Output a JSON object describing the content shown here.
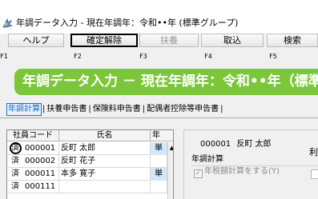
{
  "window": {
    "title": "年調データ入力 - 現在年調年：令和••年 (標準グループ)",
    "icon": "app-icon"
  },
  "toolbar": {
    "buttons": [
      {
        "label": "ヘルプ",
        "enabled": true
      },
      {
        "label": "確定解除",
        "enabled": true,
        "highlighted": true
      },
      {
        "label": "扶養",
        "enabled": false
      },
      {
        "label": "取込",
        "enabled": true
      },
      {
        "label": "検索",
        "enabled": true
      }
    ],
    "fkeys": [
      "F1",
      "F2",
      "F3",
      "F4",
      "F5"
    ]
  },
  "banner": {
    "title": "年調データ入力 － 現在年調年：令和••年（標準"
  },
  "tabs": {
    "items": [
      {
        "label": "年調計算",
        "active": true
      },
      {
        "label": "扶養申告書",
        "active": false
      },
      {
        "label": "保険料申告書",
        "active": false
      },
      {
        "label": "配偶者控除等申告書",
        "active": false
      }
    ],
    "separator": "|"
  },
  "employee_list": {
    "columns": [
      "社員コード",
      "氏名",
      "年"
    ],
    "rows": [
      {
        "status": "済",
        "code": "000001",
        "name": "反町 太郎",
        "year": "単",
        "selected": true
      },
      {
        "status": "済",
        "code": "000002",
        "name": "反町 花子",
        "year": "",
        "selected": false
      },
      {
        "status": "済",
        "code": "000011",
        "name": "本多 寛子",
        "year": "単",
        "selected": false
      },
      {
        "status": "済",
        "code": "000111",
        "name": "",
        "year": "",
        "selected": false
      }
    ],
    "scroll_up_icon": "triangle-up-icon"
  },
  "detail": {
    "employee_code": "000001",
    "employee_name": "反町 太郎",
    "group_label": "年調計算",
    "checkbox_label": "年税額計算をする(Y)",
    "checkbox_checked": true,
    "side_label": "利"
  },
  "colors": {
    "banner": "#7cc63a",
    "tab_active": "#1a6fc6",
    "year_cell": "#d2e8fa"
  }
}
